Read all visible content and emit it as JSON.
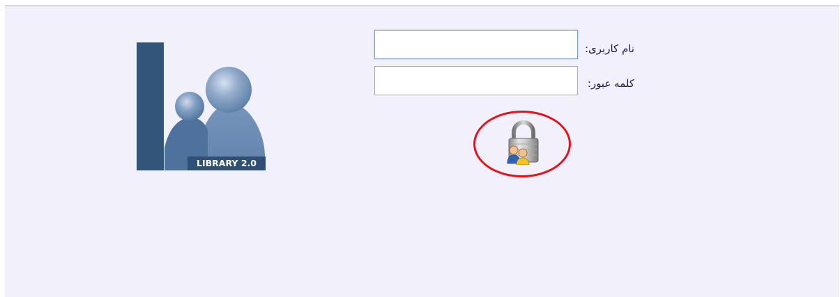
{
  "login_form": {
    "username_label": "نام کاربری:",
    "password_label": "کلمه عبور:",
    "username_value": "",
    "password_value": "",
    "login_icon": "lock-users-icon"
  },
  "logo": {
    "caption": "LIBRARY 2.0"
  },
  "colors": {
    "panel_background": "#f1f0fb",
    "logo_dark": "#34557a",
    "logo_light": "#7fa0c6",
    "highlight_ring": "#e8101c"
  }
}
